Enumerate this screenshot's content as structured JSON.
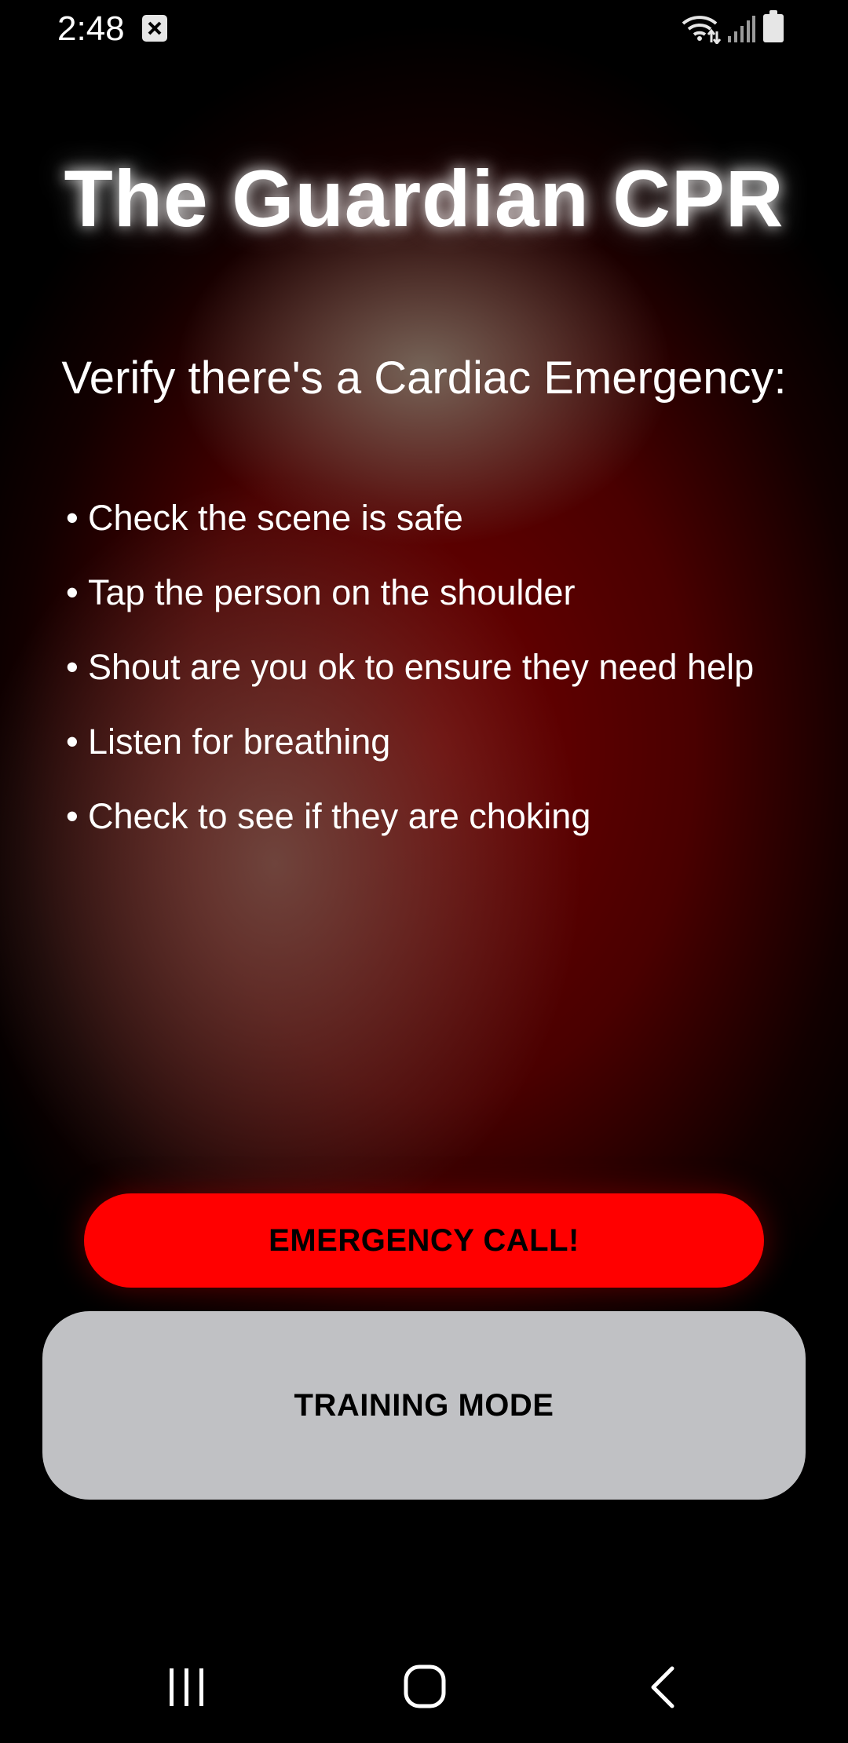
{
  "status_bar": {
    "time": "2:48",
    "icons": [
      "notification-icon",
      "wifi-icon",
      "signal-icon",
      "battery-icon"
    ]
  },
  "app": {
    "title": "The Guardian CPR",
    "subtitle": "Verify there's a Cardiac Emergency:",
    "bullet": "•",
    "checklist": [
      "Check the scene is safe",
      "Tap the person on the shoulder",
      "Shout are you ok to ensure they need help",
      "Listen for breathing",
      "Check to see if they are choking"
    ]
  },
  "buttons": {
    "emergency_label": "EMERGENCY CALL!",
    "training_label": "TRAINING MODE"
  },
  "nav_bar": {
    "icons": [
      "recents-icon",
      "home-icon",
      "back-icon"
    ]
  },
  "colors": {
    "emergency_button": "#ff0000",
    "training_button": "#c0c1c4",
    "background_glow": "#6e0000"
  }
}
